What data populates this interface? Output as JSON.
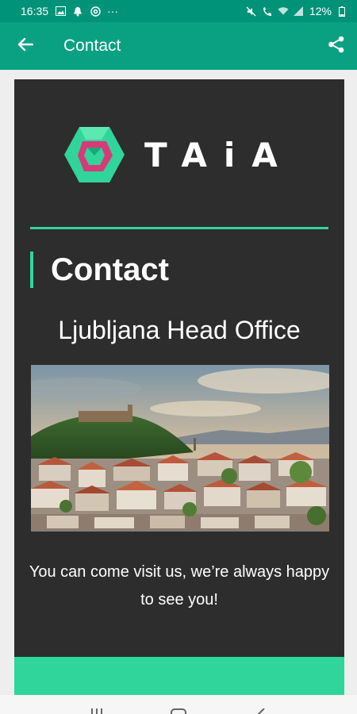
{
  "status_bar": {
    "time": "16:35",
    "more": "···",
    "battery": "12%",
    "icons": [
      "image-icon",
      "bell-icon",
      "at-icon",
      "mute-icon",
      "wifi-call-icon",
      "wifi-icon",
      "signal-icon",
      "battery-icon"
    ]
  },
  "app_bar": {
    "title": "Contact",
    "back_icon": "arrow-left-icon",
    "share_icon": "share-icon"
  },
  "logo": {
    "word": "TAiA"
  },
  "section": {
    "heading": "Contact",
    "office_title": "Ljubljana Head Office",
    "photo_subject": "city-panorama-with-castle-on-hill",
    "body": "You can come visit us, we’re always happy to see you!"
  },
  "nav_bar": {
    "icons": [
      "recents-icon",
      "home-icon",
      "back-icon"
    ]
  },
  "colors": {
    "status_bar": "#009379",
    "app_bar": "#0aa183",
    "card": "#2d2d2d",
    "accent": "#2fd59a",
    "logo_pink": "#d83a78"
  }
}
